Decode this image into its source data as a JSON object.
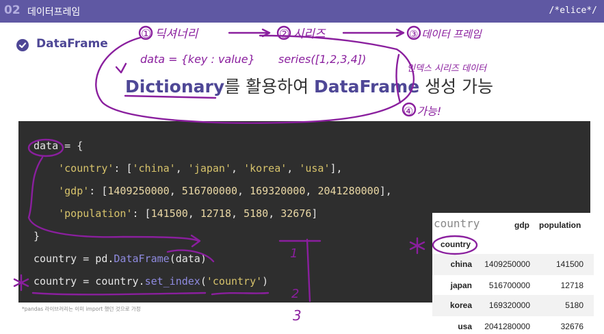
{
  "header": {
    "slide_number": "02",
    "slide_title": "데이터프레임",
    "brand": "/*elice*/"
  },
  "section": {
    "title": "DataFrame",
    "icon": "check-circle-icon"
  },
  "headline": {
    "kw1": "Dictionary",
    "mid": "를 활용하여 ",
    "kw2": "DataFrame",
    "tail": " 생성 가능"
  },
  "code": {
    "line1": "data = {",
    "country_key": "'country'",
    "country_vals": [
      "'china'",
      "'japan'",
      "'korea'",
      "'usa'"
    ],
    "gdp_key": "'gdp'",
    "gdp_vals": [
      "1409250000",
      "516700000",
      "169320000",
      "2041280000"
    ],
    "pop_key": "'population'",
    "pop_vals": [
      "141500",
      "12718",
      "5180",
      "32676"
    ],
    "close": "}",
    "l6_a": "country = pd.",
    "l6_fn": "DataFrame",
    "l6_b": "(data)",
    "l7_a": "country = country.",
    "l7_fn": "set_index",
    "l7_b": "(",
    "l7_str": "'country'",
    "l7_c": ")"
  },
  "footnote": "*pandas 라이브러리는 이미 import 했던 것으로 가정",
  "dataframe": {
    "corner_label": "country",
    "columns": [
      "gdp",
      "population"
    ],
    "index_name": "country",
    "rows": [
      {
        "index": "china",
        "gdp": "1409250000",
        "population": "141500"
      },
      {
        "index": "japan",
        "gdp": "516700000",
        "population": "12718"
      },
      {
        "index": "korea",
        "gdp": "169320000",
        "population": "5180"
      },
      {
        "index": "usa",
        "gdp": "2041280000",
        "population": "32676"
      }
    ]
  },
  "annotations": {
    "step1": "① 딕셔너리",
    "step2": "② 시리즈",
    "step3": "③ 데이터 프레임",
    "note1": "data = {key : value}",
    "note2": "series([1,2,3,4])",
    "note3": "인덱스 시리즈 데이터",
    "step4": "④ 가능!",
    "margin1": "1",
    "margin2": "2",
    "margin3": "3",
    "color": "#8a1f9e"
  }
}
